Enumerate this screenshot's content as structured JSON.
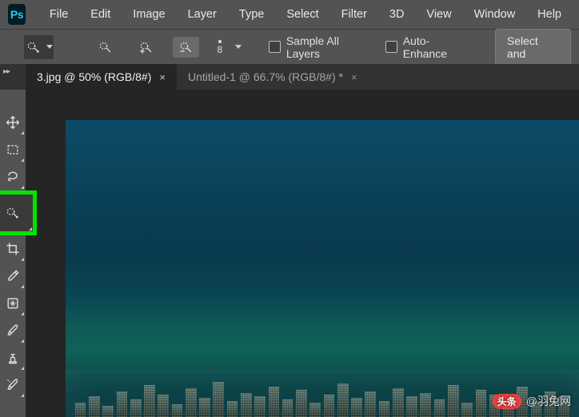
{
  "app": {
    "logo_text": "Ps"
  },
  "menu": [
    "File",
    "Edit",
    "Image",
    "Layer",
    "Type",
    "Select",
    "Filter",
    "3D",
    "View",
    "Window",
    "Help"
  ],
  "options": {
    "brush_size": "8",
    "sample_all_layers": "Sample All Layers",
    "auto_enhance": "Auto-Enhance",
    "select_and": "Select and"
  },
  "tabs": [
    {
      "label": "3.jpg @ 50% (RGB/8#)",
      "active": true
    },
    {
      "label": "Untitled-1 @ 66.7% (RGB/8#) *",
      "active": false
    }
  ],
  "watermark": {
    "pill": "头条",
    "handle": "@羽兔网"
  },
  "tools": [
    {
      "name": "move-tool"
    },
    {
      "name": "rectangular-marquee-tool"
    },
    {
      "name": "lasso-tool"
    },
    {
      "name": "quick-selection-tool",
      "highlighted": true
    },
    {
      "name": "crop-tool"
    },
    {
      "name": "eyedropper-tool"
    },
    {
      "name": "healing-brush-tool"
    },
    {
      "name": "brush-tool"
    },
    {
      "name": "clone-stamp-tool"
    },
    {
      "name": "history-brush-tool"
    }
  ]
}
